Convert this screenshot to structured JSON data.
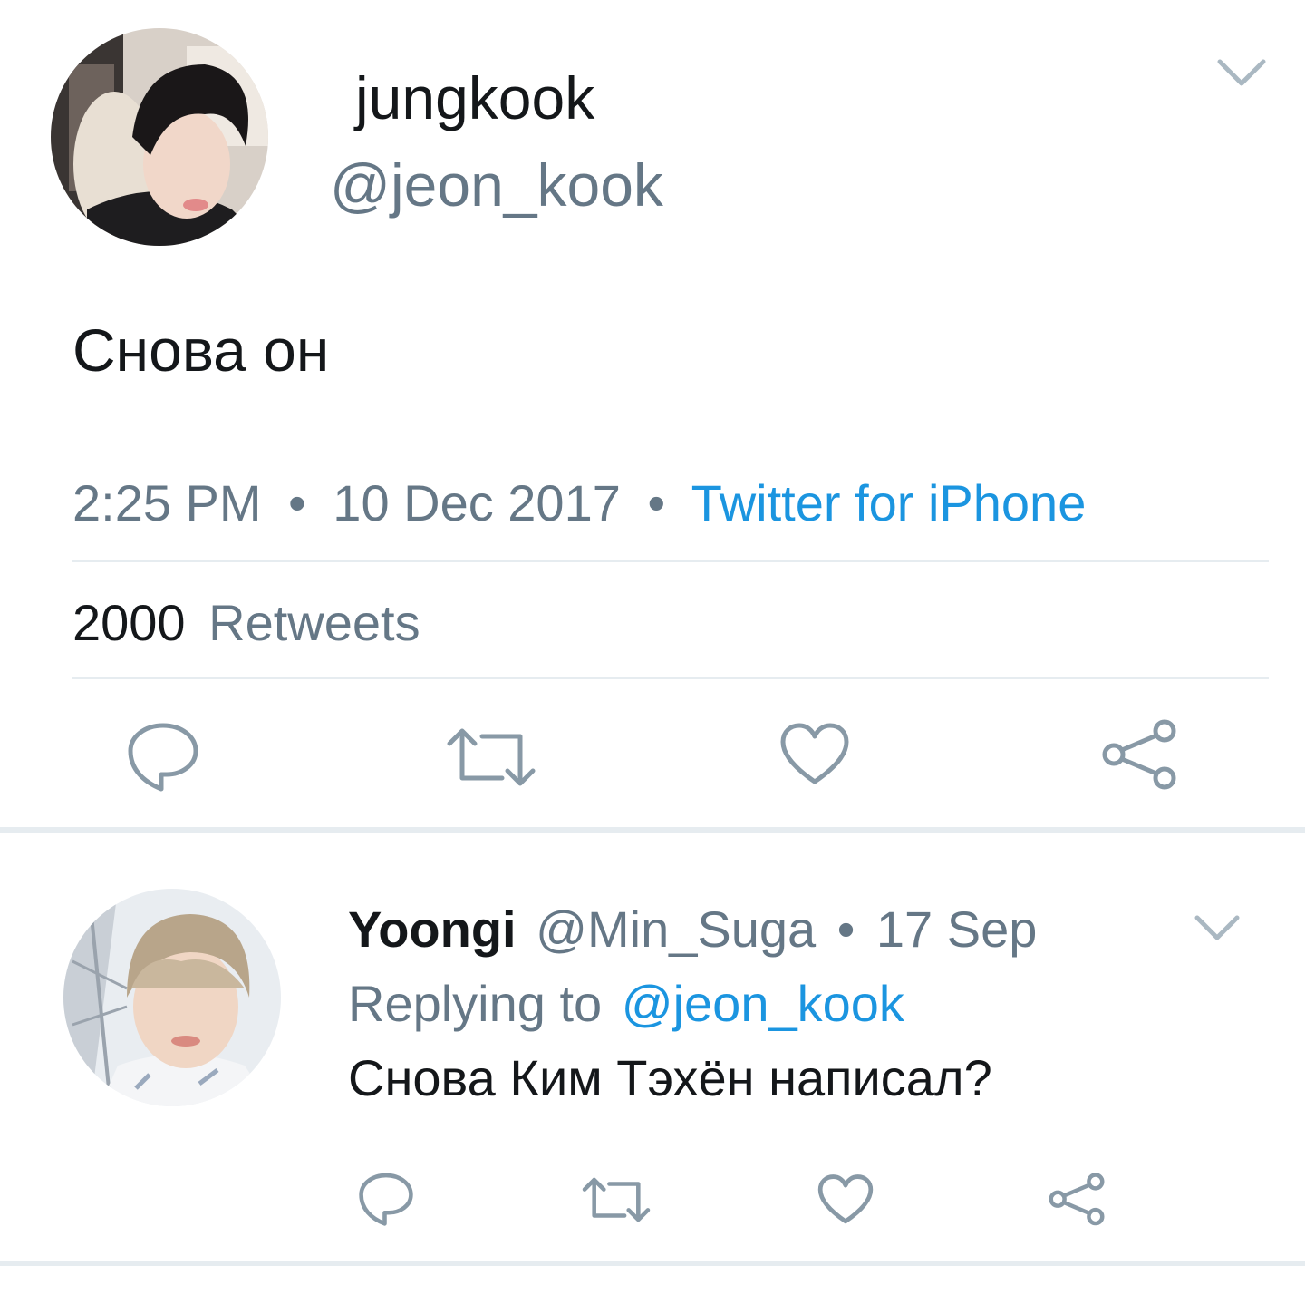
{
  "main_tweet": {
    "display_name": "jungkook",
    "handle": "@jeon_kook",
    "text": "Снова он",
    "time": "2:25 PM",
    "separator": "•",
    "date": "10 Dec 2017",
    "source": "Twitter for iPhone",
    "retweet_count": "2000",
    "retweet_label": "Retweets",
    "actions": [
      "reply-icon",
      "retweet-icon",
      "like-icon",
      "share-icon"
    ]
  },
  "reply_tweet": {
    "display_name": "Yoongi",
    "handle": "@Min_Suga",
    "separator": "•",
    "date": "17 Sep",
    "replying_to_label": "Replying to",
    "replying_to_handle": "@jeon_kook",
    "text": "Снова Ким Тэхён написал?",
    "actions": [
      "reply-icon",
      "retweet-icon",
      "like-icon",
      "share-icon"
    ]
  },
  "colors": {
    "text": "#14171a",
    "secondary": "#657786",
    "link": "#1b95e0",
    "icon": "#8899a6",
    "divider": "#e6ecf0"
  }
}
